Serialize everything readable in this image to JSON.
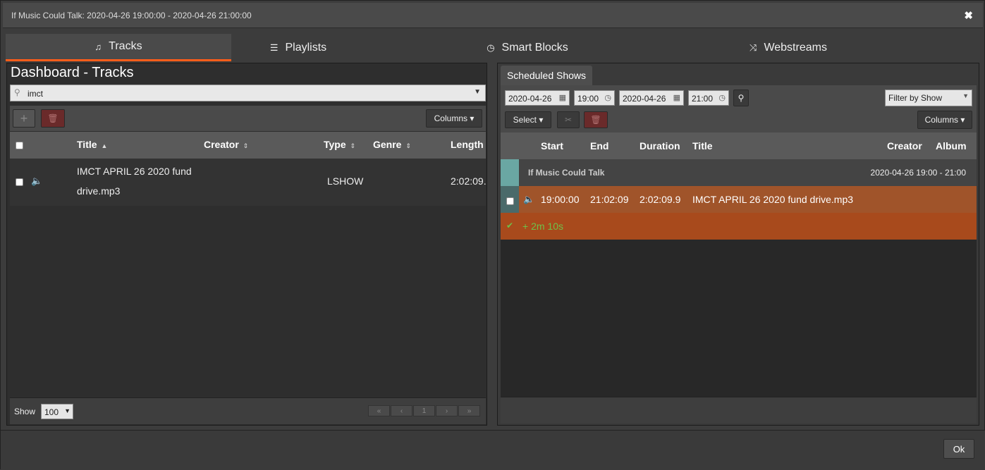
{
  "window": {
    "title": "If Music Could Talk: 2020-04-26 19:00:00 - 2020-04-26 21:00:00",
    "close": "✖"
  },
  "tabs": [
    {
      "label": "Tracks",
      "icon": "♫"
    },
    {
      "label": "Playlists",
      "icon": "☰"
    },
    {
      "label": "Smart Blocks",
      "icon": "◷"
    },
    {
      "label": "Webstreams",
      "icon": "⤨"
    }
  ],
  "library": {
    "title": "Dashboard - Tracks",
    "search_value": "imct",
    "add_label": "+",
    "delete_label": "🗑",
    "columns_label": "Columns ▾",
    "headers": {
      "title": "Title",
      "creator": "Creator",
      "type": "Type",
      "genre": "Genre",
      "length": "Length"
    },
    "rows": [
      {
        "title_line1": "IMCT APRIL 26 2020 fund",
        "title_line2": "drive.mp3",
        "type": "LSHOW",
        "length": "2:02:09."
      }
    ],
    "show_label": "Show",
    "show_value": "100",
    "pager": [
      "«",
      "‹",
      "1",
      "›",
      "»"
    ]
  },
  "schedule": {
    "tab_label": "Scheduled Shows",
    "start_date": "2020-04-26",
    "start_time": "19:00",
    "end_date": "2020-04-26",
    "end_time": "21:00",
    "filter_label": "Filter by Show",
    "select_label": "Select ▾",
    "columns_label": "Columns ▾",
    "headers": {
      "start": "Start",
      "end": "End",
      "duration": "Duration",
      "title": "Title",
      "creator": "Creator",
      "album": "Album"
    },
    "show": {
      "name": "If Music Could Talk",
      "time": "2020-04-26  19:00  -  21:00"
    },
    "track": {
      "start": "19:00:00",
      "end": "21:02:09",
      "duration": "2:02:09.9",
      "title": "IMCT APRIL 26 2020 fund drive.mp3"
    },
    "gap": "+ 2m 10s"
  },
  "ok_label": "Ok"
}
